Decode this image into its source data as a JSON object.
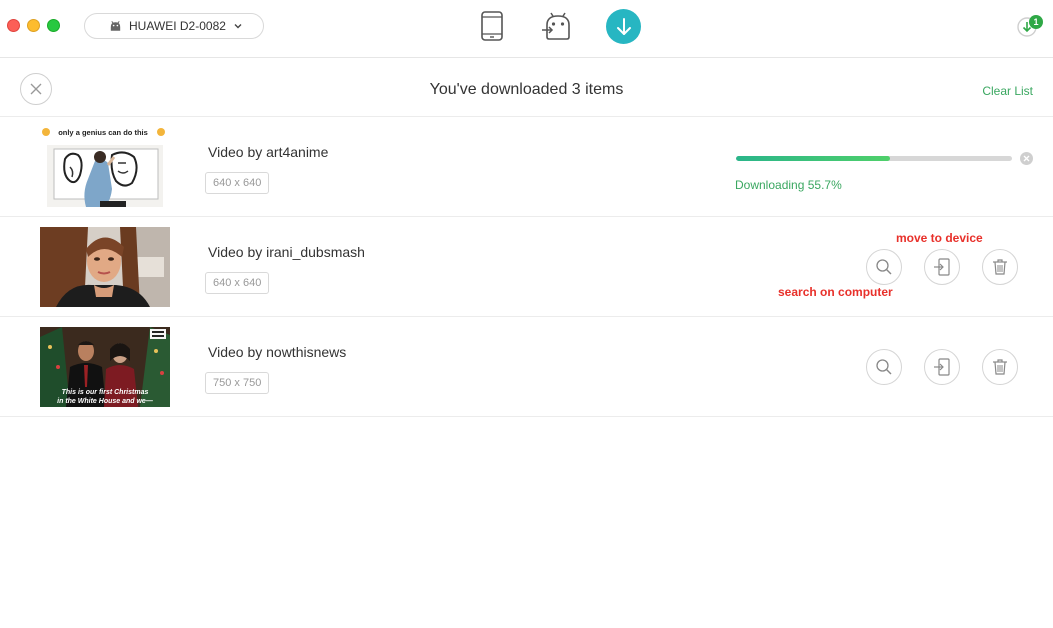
{
  "window": {
    "traffic_lights": [
      "close",
      "minimize",
      "zoom"
    ],
    "device_select": {
      "label": "HUAWEI D2-0082",
      "icon": "android-icon"
    },
    "top_icons": [
      "phone-icon",
      "android-transfer-icon",
      "download-icon"
    ],
    "notification": {
      "badge_count": "1",
      "icon": "download-notification-icon"
    },
    "colors": {
      "accent": "#27b6c2",
      "green": "#3aa760",
      "badge": "#2fa846",
      "annotation": "#e8302a"
    }
  },
  "header": {
    "title": "You've downloaded 3 items",
    "clear_label": "Clear List",
    "close_icon": "close-icon"
  },
  "items": [
    {
      "title": "Video by art4anime",
      "dimensions": "640 x 640",
      "thumbnail_caption": "only a genius can do this",
      "status": "Downloading 55.7%",
      "progress": 0.557
    },
    {
      "title": "Video by irani_dubsmash",
      "dimensions": "640 x 640",
      "actions": [
        "search-icon",
        "move-to-device-icon",
        "trash-icon"
      ]
    },
    {
      "title": "Video by nowthisnews",
      "dimensions": "750 x 750",
      "thumbnail_caption_1": "This is our first Christmas",
      "thumbnail_caption_2": "in the White House and we—",
      "actions": [
        "search-icon",
        "move-to-device-icon",
        "trash-icon"
      ]
    }
  ],
  "annotations": {
    "move": "move to device",
    "search": "search on computer"
  }
}
